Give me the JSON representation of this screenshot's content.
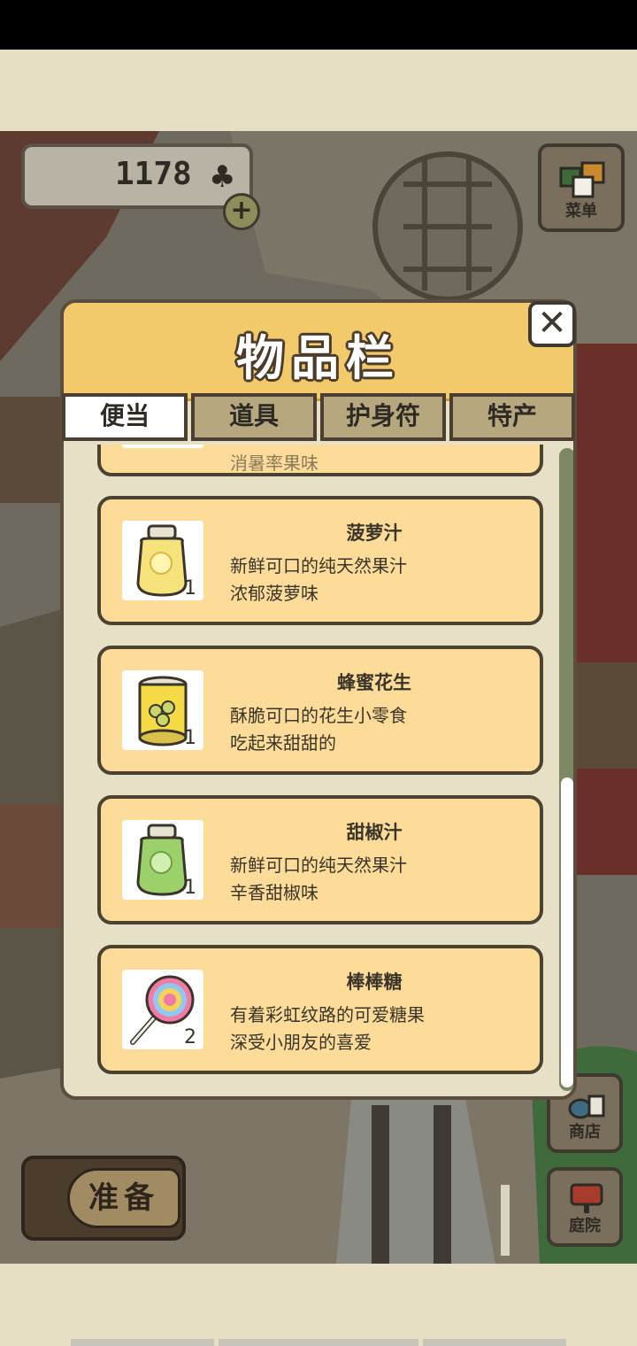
{
  "hud": {
    "clover_count": "1178",
    "clover_icon": "clover-icon",
    "plus_label": "+",
    "menu_label": "菜单",
    "shop_label": "商店",
    "yard_label": "庭院",
    "ready_label": "准备"
  },
  "inventory": {
    "title": "物品栏",
    "close_label": "✕",
    "tabs": [
      {
        "label": "便当",
        "active": true
      },
      {
        "label": "道具",
        "active": false
      },
      {
        "label": "护身符",
        "active": false
      },
      {
        "label": "特产",
        "active": false
      }
    ],
    "partial_item_text": "消暑率果味",
    "items": [
      {
        "name": "菠萝汁",
        "line1": "新鲜可口的纯天然果汁",
        "line2": "浓郁菠萝味",
        "qty": "1",
        "icon": "pineapple-juice-jar-icon"
      },
      {
        "name": "蜂蜜花生",
        "line1": "酥脆可口的花生小零食",
        "line2": "吃起来甜甜的",
        "qty": "1",
        "icon": "honey-peanut-can-icon"
      },
      {
        "name": "甜椒汁",
        "line1": "新鲜可口的纯天然果汁",
        "line2": "辛香甜椒味",
        "qty": "1",
        "icon": "pepper-juice-jar-icon"
      },
      {
        "name": "棒棒糖",
        "line1": "有着彩虹纹路的可爱糖果",
        "line2": "深受小朋友的喜爱",
        "qty": "2",
        "icon": "lollipop-icon"
      }
    ],
    "scroll_position": 0.85
  },
  "colors": {
    "panel_header": "#f2c96b",
    "item_card": "#fddc99",
    "panel_body": "#e6e0c6",
    "scroll_track": "#7d8864"
  }
}
